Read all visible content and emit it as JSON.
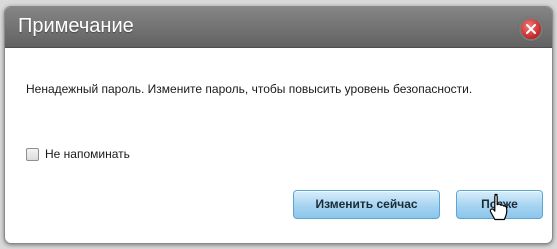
{
  "dialog": {
    "title": "Примечание",
    "message": "Ненадежный пароль. Измените пароль, чтобы повысить уровень безопасности.",
    "remind_checkbox": {
      "label": "Не напоминать",
      "checked": false
    },
    "buttons": {
      "change_now": "Изменить сейчас",
      "later": "Позже"
    },
    "close_icon": "close-icon"
  },
  "colors": {
    "titlebar": "#737373",
    "button_accent": "#a6d3f0",
    "close_button": "#c42727"
  }
}
